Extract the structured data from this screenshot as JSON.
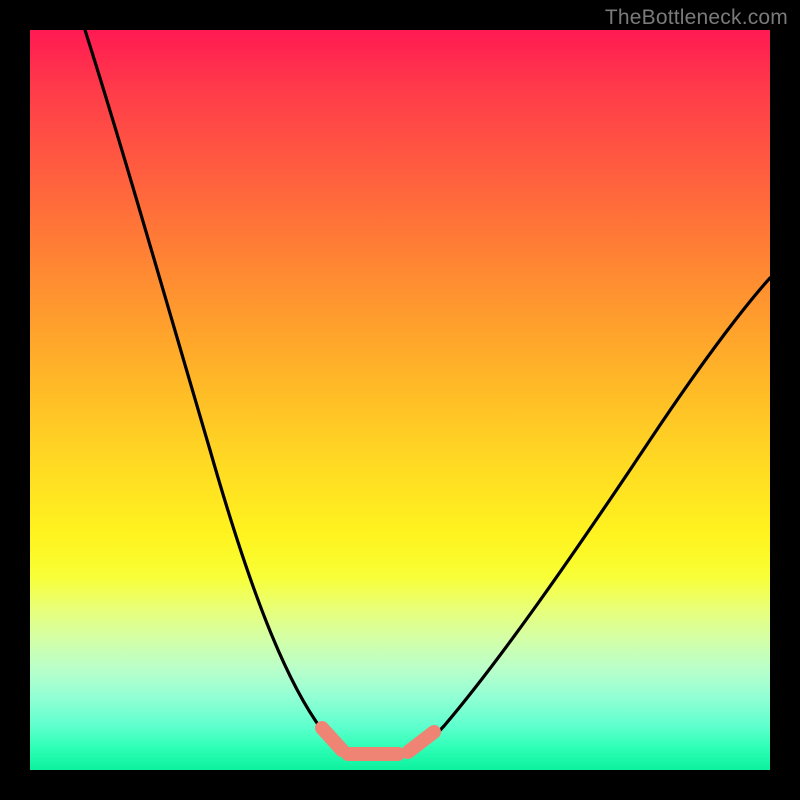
{
  "watermark": "TheBottleneck.com",
  "colors": {
    "background": "#000000",
    "gradient_top": "#ff1a52",
    "gradient_bottom": "#00f09a",
    "curve": "#000000",
    "marker": "#f08474"
  },
  "chart_data": {
    "type": "line",
    "title": "",
    "xlabel": "",
    "ylabel": "",
    "xlim": [
      0,
      100
    ],
    "ylim": [
      0,
      100
    ],
    "grid": false,
    "legend": false,
    "series": [
      {
        "name": "bottleneck-curve",
        "x": [
          8,
          12,
          16,
          20,
          24,
          28,
          32,
          36,
          38,
          40,
          42,
          44,
          46,
          48,
          50,
          54,
          58,
          62,
          66,
          70,
          76,
          82,
          88,
          94,
          100
        ],
        "y": [
          100,
          88,
          76,
          64,
          53,
          42,
          32,
          22,
          17,
          12,
          8,
          5,
          3,
          2,
          2,
          2,
          3,
          6,
          10,
          15,
          22,
          30,
          38,
          46,
          54
        ]
      }
    ],
    "annotations": [
      {
        "name": "minimum-plateau-marker",
        "x_range": [
          40,
          52
        ],
        "y": 2
      }
    ]
  }
}
